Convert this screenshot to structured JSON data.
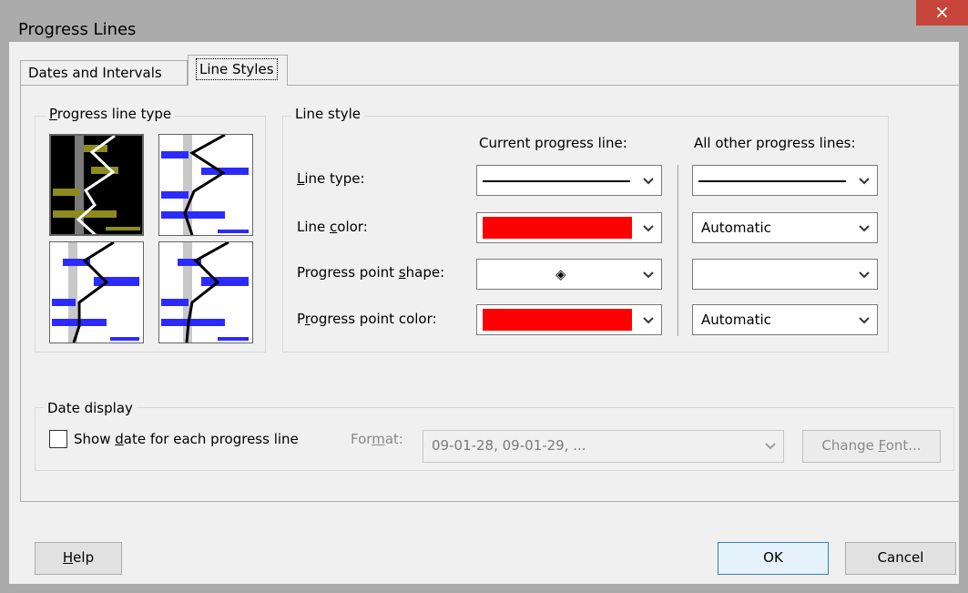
{
  "window": {
    "title": "Progress Lines",
    "close_glyph": "×"
  },
  "tabs": [
    {
      "label": "Dates and Intervals",
      "selected": false
    },
    {
      "label": "Line Styles",
      "selected": true
    }
  ],
  "progress_line_type": {
    "legend_prefix": "P",
    "legend_rest": "rogress line type",
    "options": [
      {
        "name": "style-1",
        "selected": true
      },
      {
        "name": "style-2",
        "selected": false
      },
      {
        "name": "style-3",
        "selected": false
      },
      {
        "name": "style-4",
        "selected": false
      }
    ]
  },
  "line_style": {
    "legend": "Line style",
    "col_current": "Current progress line:",
    "col_other": "All other progress lines:",
    "rows": {
      "line_type": {
        "label_pre": "",
        "label_u": "L",
        "label_post": "ine type:"
      },
      "line_color": {
        "label_pre": "Line ",
        "label_u": "c",
        "label_post": "olor:",
        "current_color": "#ff0000",
        "other_value": "Automatic"
      },
      "point_shape": {
        "label_pre": "Progress point ",
        "label_u": "s",
        "label_post": "hape:",
        "current_shape": "◈"
      },
      "point_color": {
        "label_pre": "P",
        "label_u": "r",
        "label_post": "ogress point color:",
        "current_color": "#ff0000",
        "other_value": "Automatic"
      }
    }
  },
  "date_display": {
    "legend": "Date display",
    "checkbox_pre": "Show ",
    "checkbox_u": "d",
    "checkbox_post": "ate for each progress line",
    "checked": false,
    "format_pre": "For",
    "format_u": "m",
    "format_post": "at:",
    "format_value": "09-01-28, 09-01-29, ...",
    "change_font_pre": "Change ",
    "change_font_u": "F",
    "change_font_post": "ont..."
  },
  "buttons": {
    "help_u": "H",
    "help_rest": "elp",
    "ok": "OK",
    "cancel": "Cancel"
  },
  "colors": {
    "titlebar": "#ababab",
    "close": "#c7453a",
    "accent_red": "#ff0000",
    "bar_blue": "#2b2bff",
    "bar_yellow": "#8c8c1e"
  }
}
